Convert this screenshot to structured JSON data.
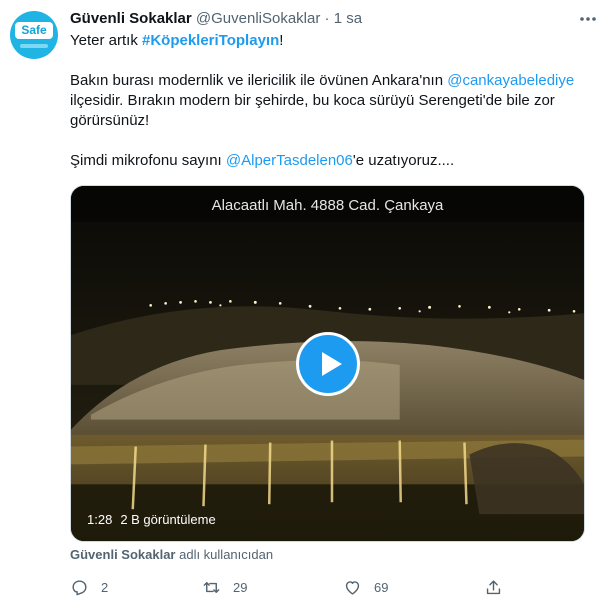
{
  "author": {
    "avatar_label": "Safe",
    "name": "Güvenli Sokaklar",
    "handle": "@GuvenliSokaklar",
    "separator": "·",
    "time": "1 sa"
  },
  "tweet": {
    "line1_prefix": "Yeter artık ",
    "hashtag": "#KöpekleriToplayın",
    "line1_suffix": "!",
    "p2_prefix": "Bakın burası modernlik ve ilericilik ile övünen Ankara'nın ",
    "mention1": "@cankayabelediye",
    "p2_suffix": " ilçesidir. Bırakın modern bir şehirde, bu koca sürüyü Serengeti'de bile zor görürsünüz!",
    "p3_prefix": "Şimdi mikrofonu sayını ",
    "mention2": "@AlperTasdelen06",
    "p3_suffix": "'e uzatıyoruz...."
  },
  "media": {
    "overlay_title": "Alacaatlı Mah. 4888 Cad. Çankaya",
    "duration": "1:28",
    "views": "2 B görüntüleme"
  },
  "attribution": {
    "name": "Güvenli Sokaklar",
    "suffix": " adlı kullanıcıdan"
  },
  "actions": {
    "reply_count": "2",
    "retweet_count": "29",
    "like_count": "69"
  },
  "colors": {
    "link": "#1d9bf0",
    "secondary_text": "#536471",
    "play_button": "#1d9bf0"
  },
  "icons": {
    "more": "more-horizontal-icon",
    "reply": "reply-icon",
    "retweet": "retweet-icon",
    "like": "heart-icon",
    "share": "share-icon",
    "play": "play-icon"
  }
}
